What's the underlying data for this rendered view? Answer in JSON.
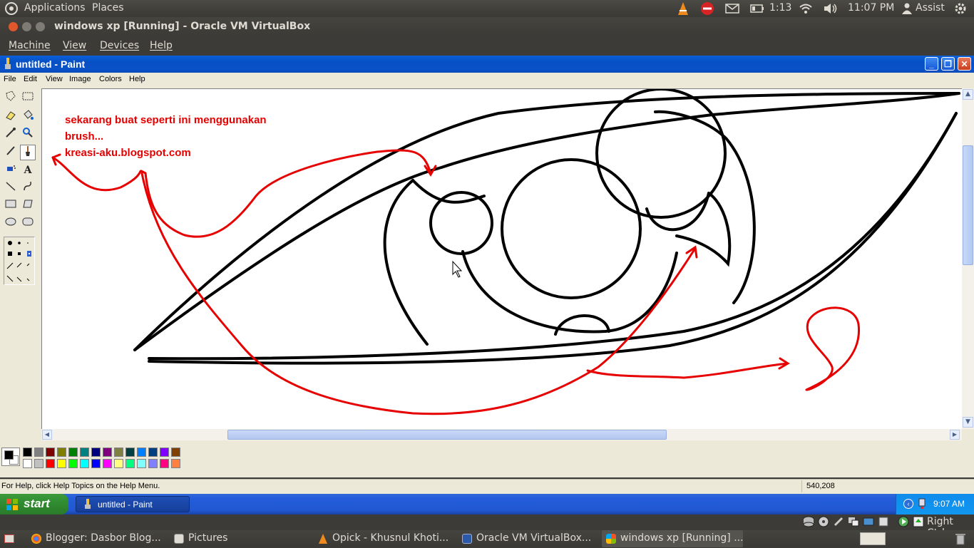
{
  "top_panel": {
    "applications": "Applications",
    "places": "Places",
    "battery_time": "1:13",
    "clock": "11:07 PM",
    "user": "Assist"
  },
  "vbox": {
    "title": "windows xp [Running] - Oracle VM VirtualBox",
    "menu": [
      "Machine",
      "View",
      "Devices",
      "Help"
    ],
    "host_key": "Right Ctrl"
  },
  "paint": {
    "title": "untitled - Paint",
    "menu": [
      "File",
      "Edit",
      "View",
      "Image",
      "Colors",
      "Help"
    ],
    "status_help": "For Help, click Help Topics on the Help Menu.",
    "status_coords": "540,208",
    "palette_row1": [
      "#000000",
      "#808080",
      "#800000",
      "#808000",
      "#008000",
      "#008080",
      "#000080",
      "#800080",
      "#808040",
      "#004040",
      "#0080ff",
      "#004080",
      "#8000ff",
      "#804000"
    ],
    "palette_row2": [
      "#ffffff",
      "#c0c0c0",
      "#ff0000",
      "#ffff00",
      "#00ff00",
      "#00ffff",
      "#0000ff",
      "#ff00ff",
      "#ffff80",
      "#00ff80",
      "#80ffff",
      "#8080ff",
      "#ff0080",
      "#ff8040"
    ]
  },
  "canvas": {
    "annotation_lines": [
      "sekarang buat seperti ini menggunakan",
      "brush...",
      "kreasi-aku.blogspot.com"
    ]
  },
  "xp": {
    "start_label": "start",
    "task_label": "untitled - Paint",
    "tray_time": "9:07 AM"
  },
  "bottom_panel": {
    "tasks": [
      "Blogger: Dasbor Blog...",
      "Pictures",
      "Opick - Khusnul Khoti...",
      "Oracle VM VirtualBox...",
      "windows xp [Running] ..."
    ]
  }
}
